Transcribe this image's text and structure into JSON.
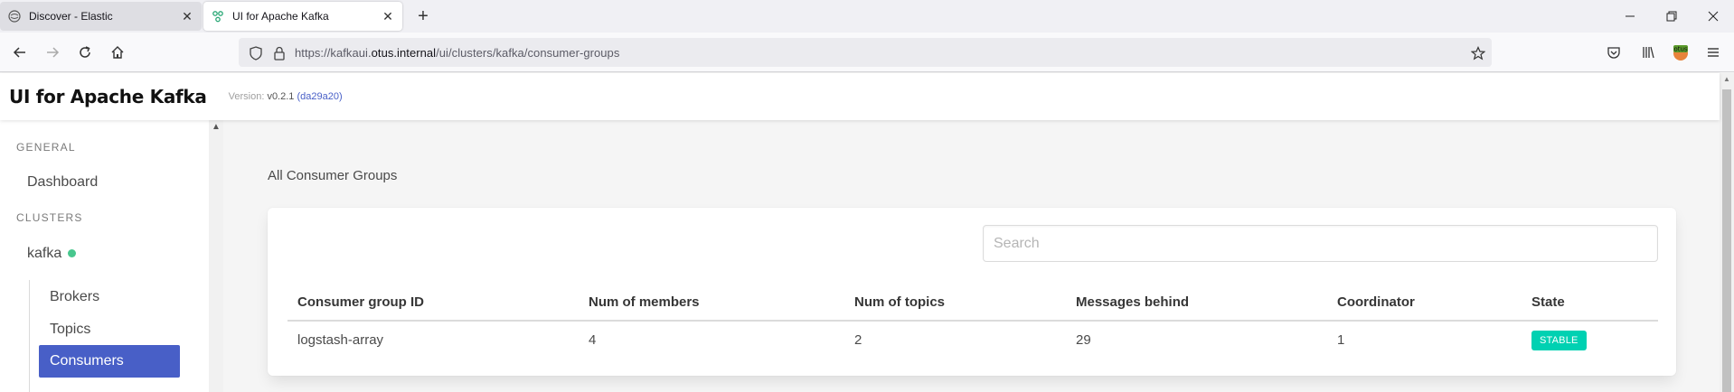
{
  "browser": {
    "tabs": [
      {
        "title": "Discover - Elastic",
        "icon": "elastic-icon",
        "active": false
      },
      {
        "title": "UI for Apache Kafka",
        "icon": "kafka-icon",
        "active": true
      }
    ],
    "url_prefix": "https://kafkaui.",
    "url_host": "otus.internal",
    "url_path": "/ui/clusters/kafka/consumer-groups"
  },
  "header": {
    "title": "UI for Apache Kafka",
    "version_label": "Version:",
    "version": "v0.2.1",
    "commit": "(da29a20)"
  },
  "sidebar": {
    "general_label": "GENERAL",
    "dashboard": "Dashboard",
    "clusters_label": "CLUSTERS",
    "cluster_name": "kafka",
    "cluster_status_color": "#48c78e",
    "items": [
      {
        "label": "Brokers",
        "active": false
      },
      {
        "label": "Topics",
        "active": false
      },
      {
        "label": "Consumers",
        "active": true
      }
    ]
  },
  "main": {
    "heading": "All Consumer Groups",
    "search_placeholder": "Search",
    "columns": [
      "Consumer group ID",
      "Num of members",
      "Num of topics",
      "Messages behind",
      "Coordinator",
      "State"
    ],
    "rows": [
      {
        "group_id": "logstash-array",
        "members": "4",
        "topics": "2",
        "messages_behind": "29",
        "coordinator": "1",
        "state": "STABLE"
      }
    ]
  },
  "colors": {
    "accent": "#485fc7",
    "state_stable": "#00d1b2"
  }
}
